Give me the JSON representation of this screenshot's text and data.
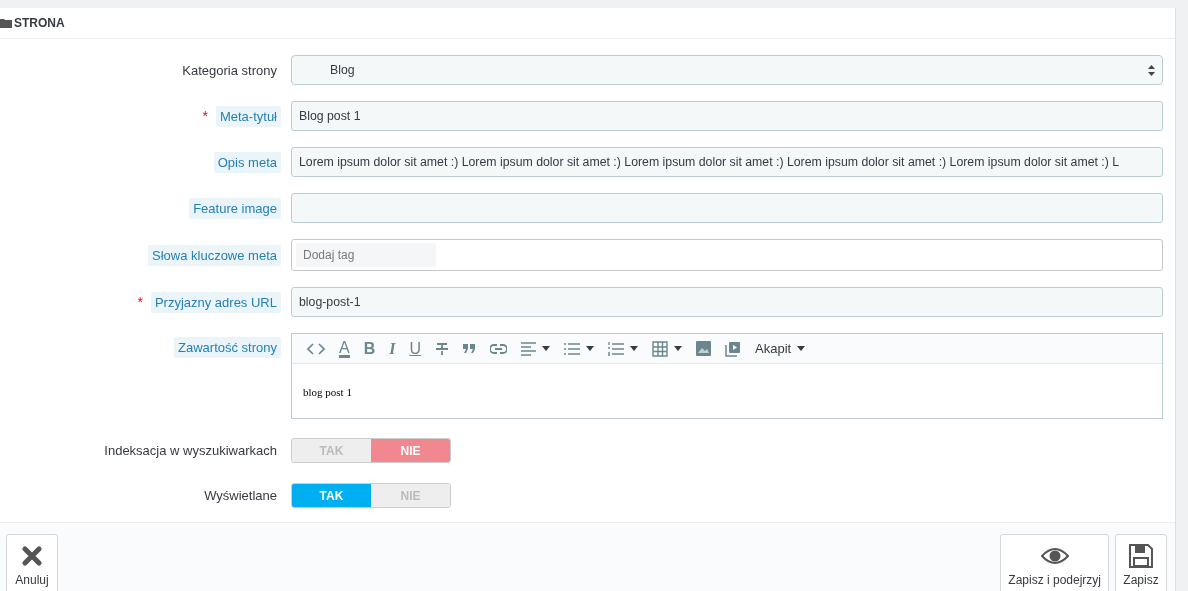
{
  "panel": {
    "title": "STRONA"
  },
  "fields": [
    {
      "kind": "select",
      "label": "Kategoria strony",
      "hint": false,
      "value": "Blog"
    },
    {
      "kind": "text",
      "label": "Meta-tytuł",
      "required_mark": "*",
      "hint": true,
      "value": "Blog post 1"
    },
    {
      "kind": "text",
      "label": "Opis meta",
      "hint": true,
      "value": "Lorem ipsum dolor sit amet :) Lorem ipsum dolor sit amet :) Lorem ipsum dolor sit amet :) Lorem ipsum dolor sit amet :) Lorem ipsum dolor sit amet :) L"
    },
    {
      "kind": "text",
      "label": "Feature image",
      "hint": true
    },
    {
      "kind": "tags",
      "label": "Słowa kluczowe meta",
      "hint": true,
      "placeholder": "Dodaj tag"
    },
    {
      "kind": "text",
      "label": "Przyjazny adres URL",
      "required_mark": "*",
      "hint": true,
      "value": "blog-post-1"
    },
    {
      "kind": "editor",
      "label": "Zawartość strony",
      "hint": true,
      "content": "blog post 1",
      "toolbar": [
        {
          "kind": "code"
        },
        {
          "kind": "color",
          "text": "A"
        },
        {
          "kind": "bold",
          "text": "B"
        },
        {
          "kind": "italic",
          "text": "I"
        },
        {
          "kind": "underline",
          "text": "U"
        },
        {
          "kind": "strike"
        },
        {
          "kind": "quote"
        },
        {
          "kind": "link"
        },
        {
          "kind": "align",
          "dropdown": true
        },
        {
          "kind": "bullets",
          "dropdown": true
        },
        {
          "kind": "numbers",
          "dropdown": true
        },
        {
          "kind": "table",
          "dropdown": true
        },
        {
          "kind": "image"
        },
        {
          "kind": "video"
        },
        {
          "kind": "format",
          "text": "Akapit",
          "dropdown": true
        }
      ]
    },
    {
      "kind": "toggle",
      "label": "Indeksacja w wyszukiwarkach",
      "hint": false,
      "options": [
        {
          "label": "TAK",
          "selected": false
        },
        {
          "label": "NIE",
          "selected": true
        }
      ]
    },
    {
      "kind": "toggle",
      "label": "Wyświetlane",
      "hint": false,
      "options": [
        {
          "label": "TAK",
          "selected": true
        },
        {
          "label": "NIE",
          "selected": false
        }
      ]
    }
  ],
  "footer": {
    "buttons": [
      {
        "kind": "cancel",
        "label": "Anuluj"
      },
      {
        "kind": "preview",
        "label": "Zapisz i podejrzyj"
      },
      {
        "kind": "save",
        "label": "Zapisz"
      }
    ]
  }
}
